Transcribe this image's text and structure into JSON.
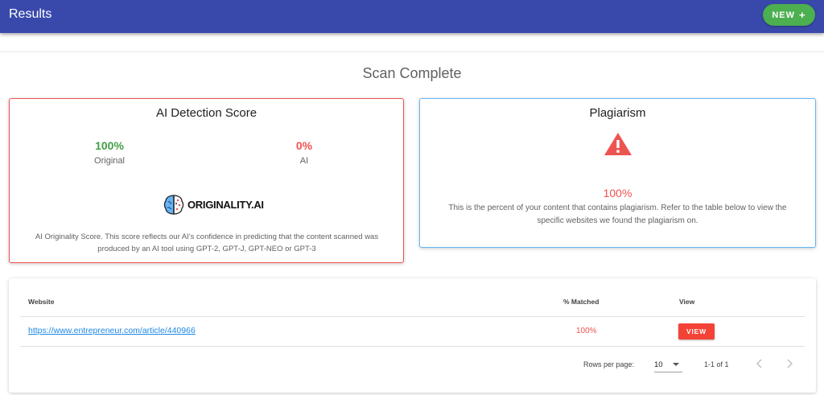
{
  "appbar": {
    "title": "Results",
    "new_label": "NEW",
    "new_icon": "plus-icon"
  },
  "scan": {
    "title": "Scan Complete"
  },
  "ai_card": {
    "title": "AI Detection Score",
    "original_value": "100%",
    "original_label": "Original",
    "ai_value": "0%",
    "ai_label": "AI",
    "logo_text": "ORIGINALITY.AI",
    "description": "AI Originality Score. This score reflects our AI's confidence in predicting that the content scanned was produced by an AI tool using GPT-2, GPT-J, GPT-NEO or GPT-3"
  },
  "plagiarism_card": {
    "title": "Plagiarism",
    "icon": "warning-icon",
    "percent": "100%",
    "description": "This is the percent of your content that contains plagiarism. Refer to the table below to view the specific websites we found the plagiarism on."
  },
  "table": {
    "columns": [
      "Website",
      "% Matched",
      "View"
    ],
    "rows": [
      {
        "website": "https://www.entrepreneur.com/article/440966",
        "matched": "100%",
        "view_label": "VIEW"
      }
    ],
    "footer": {
      "rows_per_page_label": "Rows per page:",
      "rows_per_page": "10",
      "range": "1-1 of 1"
    }
  },
  "colors": {
    "appbar": "#3949ab",
    "new_button": "#4caf50",
    "positive": "#43a047",
    "negative": "#ef5350",
    "link": "#1e88e5"
  }
}
